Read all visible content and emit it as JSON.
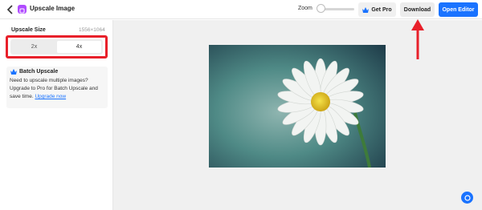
{
  "header": {
    "title": "Upscale Image",
    "zoom_label": "Zoom",
    "zoom_level": 0,
    "get_pro_label": "Get Pro",
    "download_label": "Download",
    "open_editor_label": "Open Editor"
  },
  "sidebar": {
    "upscale_size_label": "Upscale Size",
    "upscale_dimensions": "1556×1064",
    "options": [
      {
        "label": "2x",
        "selected": false
      },
      {
        "label": "4x",
        "selected": true
      }
    ],
    "batch": {
      "title": "Batch Upscale",
      "text": "Need to upscale multiple images? Upgrade to Pro for Batch Upscale and save time.",
      "link_label": "Upgrade now"
    }
  },
  "colors": {
    "accent": "#1a73ff",
    "annotation_red": "#e8202a",
    "app_icon": "#b04bff"
  },
  "icons": [
    "back-arrow-icon",
    "app-logo-icon",
    "crown-icon",
    "chat-icon"
  ]
}
